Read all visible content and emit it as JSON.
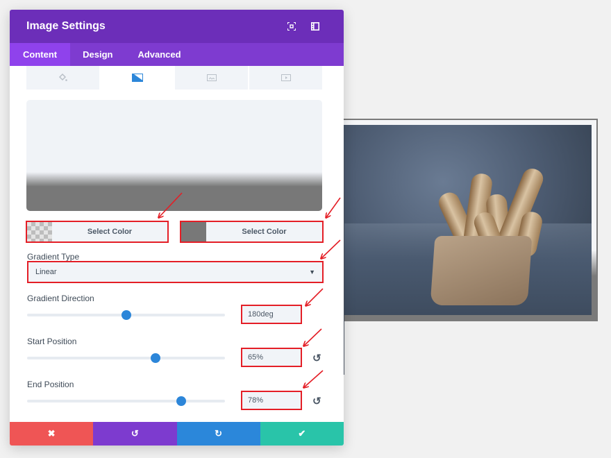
{
  "modal": {
    "title": "Image Settings",
    "header_icons": [
      "fullscreen-icon",
      "sidebar-toggle-icon"
    ],
    "tabs": [
      {
        "label": "Content",
        "active": true
      },
      {
        "label": "Design",
        "active": false
      },
      {
        "label": "Advanced",
        "active": false
      }
    ],
    "background_tabs": [
      {
        "icon": "paint-bucket-icon",
        "active": false
      },
      {
        "icon": "gradient-icon",
        "active": true
      },
      {
        "icon": "image-icon",
        "active": false
      },
      {
        "icon": "video-icon",
        "active": false
      }
    ]
  },
  "gradient": {
    "start_color": {
      "label": "Select Color",
      "color": "transparent"
    },
    "end_color": {
      "label": "Select Color",
      "color": "#787878"
    },
    "type_label": "Gradient Type",
    "type_value": "Linear",
    "direction_label": "Gradient Direction",
    "direction_value": "180deg",
    "direction_fraction": 0.5,
    "start_label": "Start Position",
    "start_value": "65%",
    "start_fraction": 0.65,
    "end_label": "End Position",
    "end_value": "78%",
    "end_fraction": 0.78
  },
  "footer": {
    "cancel_icon": "✖",
    "undo_icon": "↺",
    "redo_icon": "↻",
    "save_icon": "✔"
  },
  "colors": {
    "header": "#6c2eb9",
    "tabs": "#7e3bd0",
    "accent_blue": "#2c86d9",
    "highlight_red": "#e41e26",
    "cancel": "#ef5555",
    "save": "#29c4a9"
  }
}
